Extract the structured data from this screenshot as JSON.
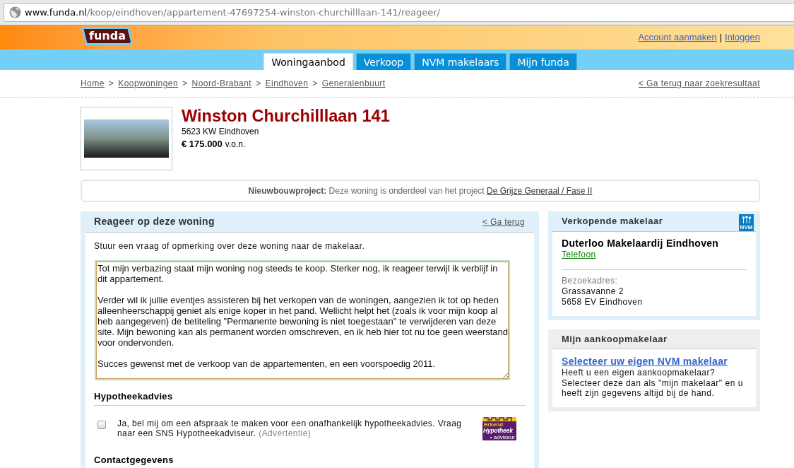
{
  "browser": {
    "url_host": "www.funda.nl",
    "url_path": "/koop/eindhoven/appartement-47697254-winston-churchilllaan-141/reageer/"
  },
  "header": {
    "logo": "funda",
    "links": [
      {
        "label": "Account aanmaken"
      },
      {
        "separator": "|",
        "label": "Inloggen"
      }
    ]
  },
  "nav_tabs": [
    {
      "label": "Woningaanbod",
      "selected": true
    },
    {
      "label": "Verkoop",
      "selected": false
    },
    {
      "label": "NVM makelaars",
      "selected": false
    },
    {
      "label": "Mijn funda",
      "selected": false
    }
  ],
  "breadcrumb": {
    "items": [
      {
        "label": "Home"
      },
      {
        "separator": ">",
        "label": "Koopwoningen"
      },
      {
        "separator": ">",
        "label": "Noord-Brabant"
      },
      {
        "separator": ">",
        "label": "Eindhoven"
      },
      {
        "separator": ">",
        "label": "Generalenbuurt"
      }
    ],
    "back_link": "< Ga terug naar zoekresultaat"
  },
  "property": {
    "title": "Winston Churchilllaan 141",
    "address": "5623 KW Eindhoven",
    "price": "€ 175.000",
    "price_suffix": "v.o.n."
  },
  "project_notice": {
    "text": "**Nieuwbouwproject:** Deze woning is onderdeel van het project",
    "link": "De Grijze Generaal / Fase II"
  },
  "reply_form": {
    "title": "Reageer op deze woning",
    "back_link": "< Ga terug",
    "intro": "Stuur een vraag of opmerking over deze woning naar de makelaar.",
    "message": {
      "value": "Tot mijn verbazing staat mijn woning nog steeds te koop. Sterker nog, ik reageer terwijl ik verblijf in dit appartement.\n\nVerder wil ik jullie eventjes assisteren bij het verkopen van de woningen, aangezien ik tot op heden alleenheerschappij geniet als enige koper in het pand. Wellicht helpt het (zoals ik voor mijn koop al heb aangegeven) de betiteling \"Permanente bewoning is niet toegestaan\" te verwijderen van deze site. Mijn bewoning kan als permanent worden omschreven, en ik heb hier tot nu toe geen weerstand voor ondervonden.\n\nSucces gewenst met de verkoop van de appartementen, en een voorspoedig 2011."
    },
    "mortgage": {
      "heading": "Hypotheekadvies",
      "checked": false,
      "text": "Ja, bel mij om een afspraak te maken voor een onafhankelijk hypotheekadvies. Vraag naar een SNS Hypotheekadviseur.",
      "note": "(Advertentie)",
      "logo_texts": [
        "Erkend",
        "Hypotheek",
        "• adviseur"
      ]
    },
    "contact_heading": "Contactgegevens"
  },
  "seller_agent": {
    "title": "Verkopende makelaar",
    "logo": "NVM",
    "name": "Duterloo Makelaardij Eindhoven",
    "phone_link": "Telefoon",
    "address_label": "Bezoekadres:",
    "address_lines": [
      "Grassavanne 2",
      "5658 EV Eindhoven"
    ]
  },
  "buyer_agent": {
    "title": "Mijn aankoopmakelaar",
    "link": "Selecteer uw eigen NVM makelaar",
    "text": "Heeft u een eigen aankoopmakelaar? Selecteer deze dan als \"mijn makelaar\" en u heeft zijn gegevens altijd bij de hand."
  }
}
